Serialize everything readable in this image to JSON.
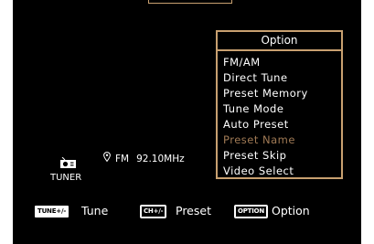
{
  "menu": {
    "title": "Option",
    "items": [
      {
        "label": "FM/AM",
        "selected": false
      },
      {
        "label": "Direct Tune",
        "selected": false
      },
      {
        "label": "Preset Memory",
        "selected": false
      },
      {
        "label": "Tune Mode",
        "selected": false
      },
      {
        "label": "Auto Preset",
        "selected": false
      },
      {
        "label": "Preset Name",
        "selected": true
      },
      {
        "label": "Preset Skip",
        "selected": false
      },
      {
        "label": "Video Select",
        "selected": false
      }
    ]
  },
  "source": {
    "label": "TUNER",
    "icon": "radio-icon"
  },
  "status": {
    "band": "FM",
    "frequency": "92.10MHz",
    "icon": "location-pin-icon"
  },
  "footer": {
    "tune_key": "TUNE+/-",
    "tune_label": "Tune",
    "preset_key": "CH+/-",
    "preset_label": "Preset",
    "option_key": "OPTION",
    "option_label": "Option"
  },
  "colors": {
    "background": "#000000",
    "accent_border": "#c8a070",
    "selected_text": "#a07a55",
    "text": "#ffffff"
  }
}
